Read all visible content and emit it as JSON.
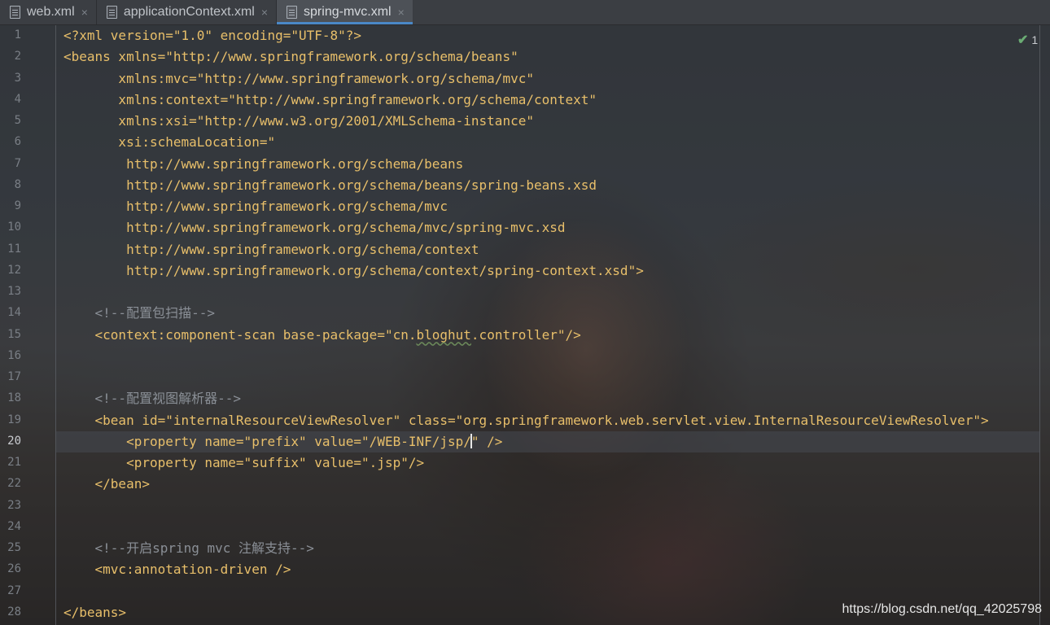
{
  "tabs": [
    {
      "label": "web.xml",
      "close": "×"
    },
    {
      "label": "applicationContext.xml",
      "close": "×"
    },
    {
      "label": "spring-mvc.xml",
      "close": "×"
    }
  ],
  "inspection": {
    "count": "1",
    "icon": "check-icon"
  },
  "code_lines": [
    {
      "n": "1",
      "text": "<?xml version=\"1.0\" encoding=\"UTF-8\"?>",
      "indent": 0
    },
    {
      "n": "2",
      "text": "<beans xmlns=\"http://www.springframework.org/schema/beans\"",
      "indent": 0
    },
    {
      "n": "3",
      "text": "       xmlns:mvc=\"http://www.springframework.org/schema/mvc\"",
      "indent": 0
    },
    {
      "n": "4",
      "text": "       xmlns:context=\"http://www.springframework.org/schema/context\"",
      "indent": 0
    },
    {
      "n": "5",
      "text": "       xmlns:xsi=\"http://www.w3.org/2001/XMLSchema-instance\"",
      "indent": 0
    },
    {
      "n": "6",
      "text": "       xsi:schemaLocation=\"",
      "indent": 0
    },
    {
      "n": "7",
      "text": "        http://www.springframework.org/schema/beans",
      "indent": 0
    },
    {
      "n": "8",
      "text": "        http://www.springframework.org/schema/beans/spring-beans.xsd",
      "indent": 0
    },
    {
      "n": "9",
      "text": "        http://www.springframework.org/schema/mvc",
      "indent": 0
    },
    {
      "n": "10",
      "text": "        http://www.springframework.org/schema/mvc/spring-mvc.xsd",
      "indent": 0
    },
    {
      "n": "11",
      "text": "        http://www.springframework.org/schema/context",
      "indent": 0
    },
    {
      "n": "12",
      "text": "        http://www.springframework.org/schema/context/spring-context.xsd\">",
      "indent": 0
    },
    {
      "n": "13",
      "text": "",
      "indent": 0
    },
    {
      "n": "14",
      "text": "    <!--配置包扫描-->",
      "indent": 0,
      "comment": true
    },
    {
      "n": "15",
      "text": "    <context:component-scan base-package=\"cn.bloghut.controller\"/>",
      "indent": 0
    },
    {
      "n": "16",
      "text": "",
      "indent": 0
    },
    {
      "n": "17",
      "text": "",
      "indent": 0
    },
    {
      "n": "18",
      "text": "    <!--配置视图解析器-->",
      "indent": 0,
      "comment": true
    },
    {
      "n": "19",
      "text": "    <bean id=\"internalResourceViewResolver\" class=\"org.springframework.web.servlet.view.InternalResourceViewResolver\">",
      "indent": 0
    },
    {
      "n": "20",
      "text": "        <property name=\"prefix\" value=\"/WEB-INF/jsp/\" />",
      "indent": 0
    },
    {
      "n": "21",
      "text": "        <property name=\"suffix\" value=\".jsp\"/>",
      "indent": 0
    },
    {
      "n": "22",
      "text": "    </bean>",
      "indent": 0
    },
    {
      "n": "23",
      "text": "",
      "indent": 0
    },
    {
      "n": "24",
      "text": "",
      "indent": 0
    },
    {
      "n": "25",
      "text": "    <!--开启spring mvc 注解支持-->",
      "indent": 0,
      "comment": true
    },
    {
      "n": "26",
      "text": "    <mvc:annotation-driven />",
      "indent": 0
    },
    {
      "n": "27",
      "text": "",
      "indent": 0
    },
    {
      "n": "28",
      "text": "</beans>",
      "indent": 0
    }
  ],
  "current_line": "20",
  "watermark": "https://blog.csdn.net/qq_42025798",
  "colors": {
    "tag": "#e8bf6a",
    "comment": "#8a8f96",
    "accent": "#4a88c7"
  }
}
